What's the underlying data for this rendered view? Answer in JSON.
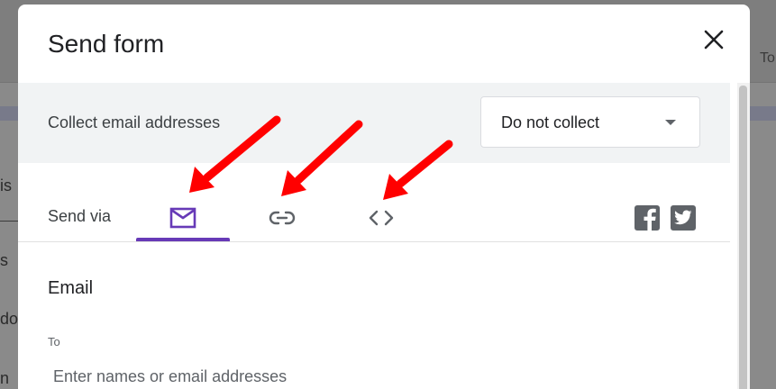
{
  "background": {
    "right_fragment": "To",
    "left_fragments": [
      "is",
      "s",
      "do",
      "n"
    ]
  },
  "dialog": {
    "title": "Send form",
    "close_icon": "close-icon"
  },
  "collect": {
    "label": "Collect email addresses",
    "selected": "Do not collect"
  },
  "send_via": {
    "label": "Send via",
    "tabs": [
      {
        "icon": "email-icon",
        "active": true
      },
      {
        "icon": "link-icon",
        "active": false
      },
      {
        "icon": "embed-code-icon",
        "active": false
      }
    ],
    "social": [
      "facebook-icon",
      "twitter-icon"
    ]
  },
  "email_section": {
    "heading": "Email",
    "to_label": "To",
    "to_placeholder": "Enter names or email addresses",
    "to_value": ""
  },
  "colors": {
    "accent": "#673ab7",
    "annotation": "#ff0000",
    "panel_bg": "#f1f3f4"
  }
}
